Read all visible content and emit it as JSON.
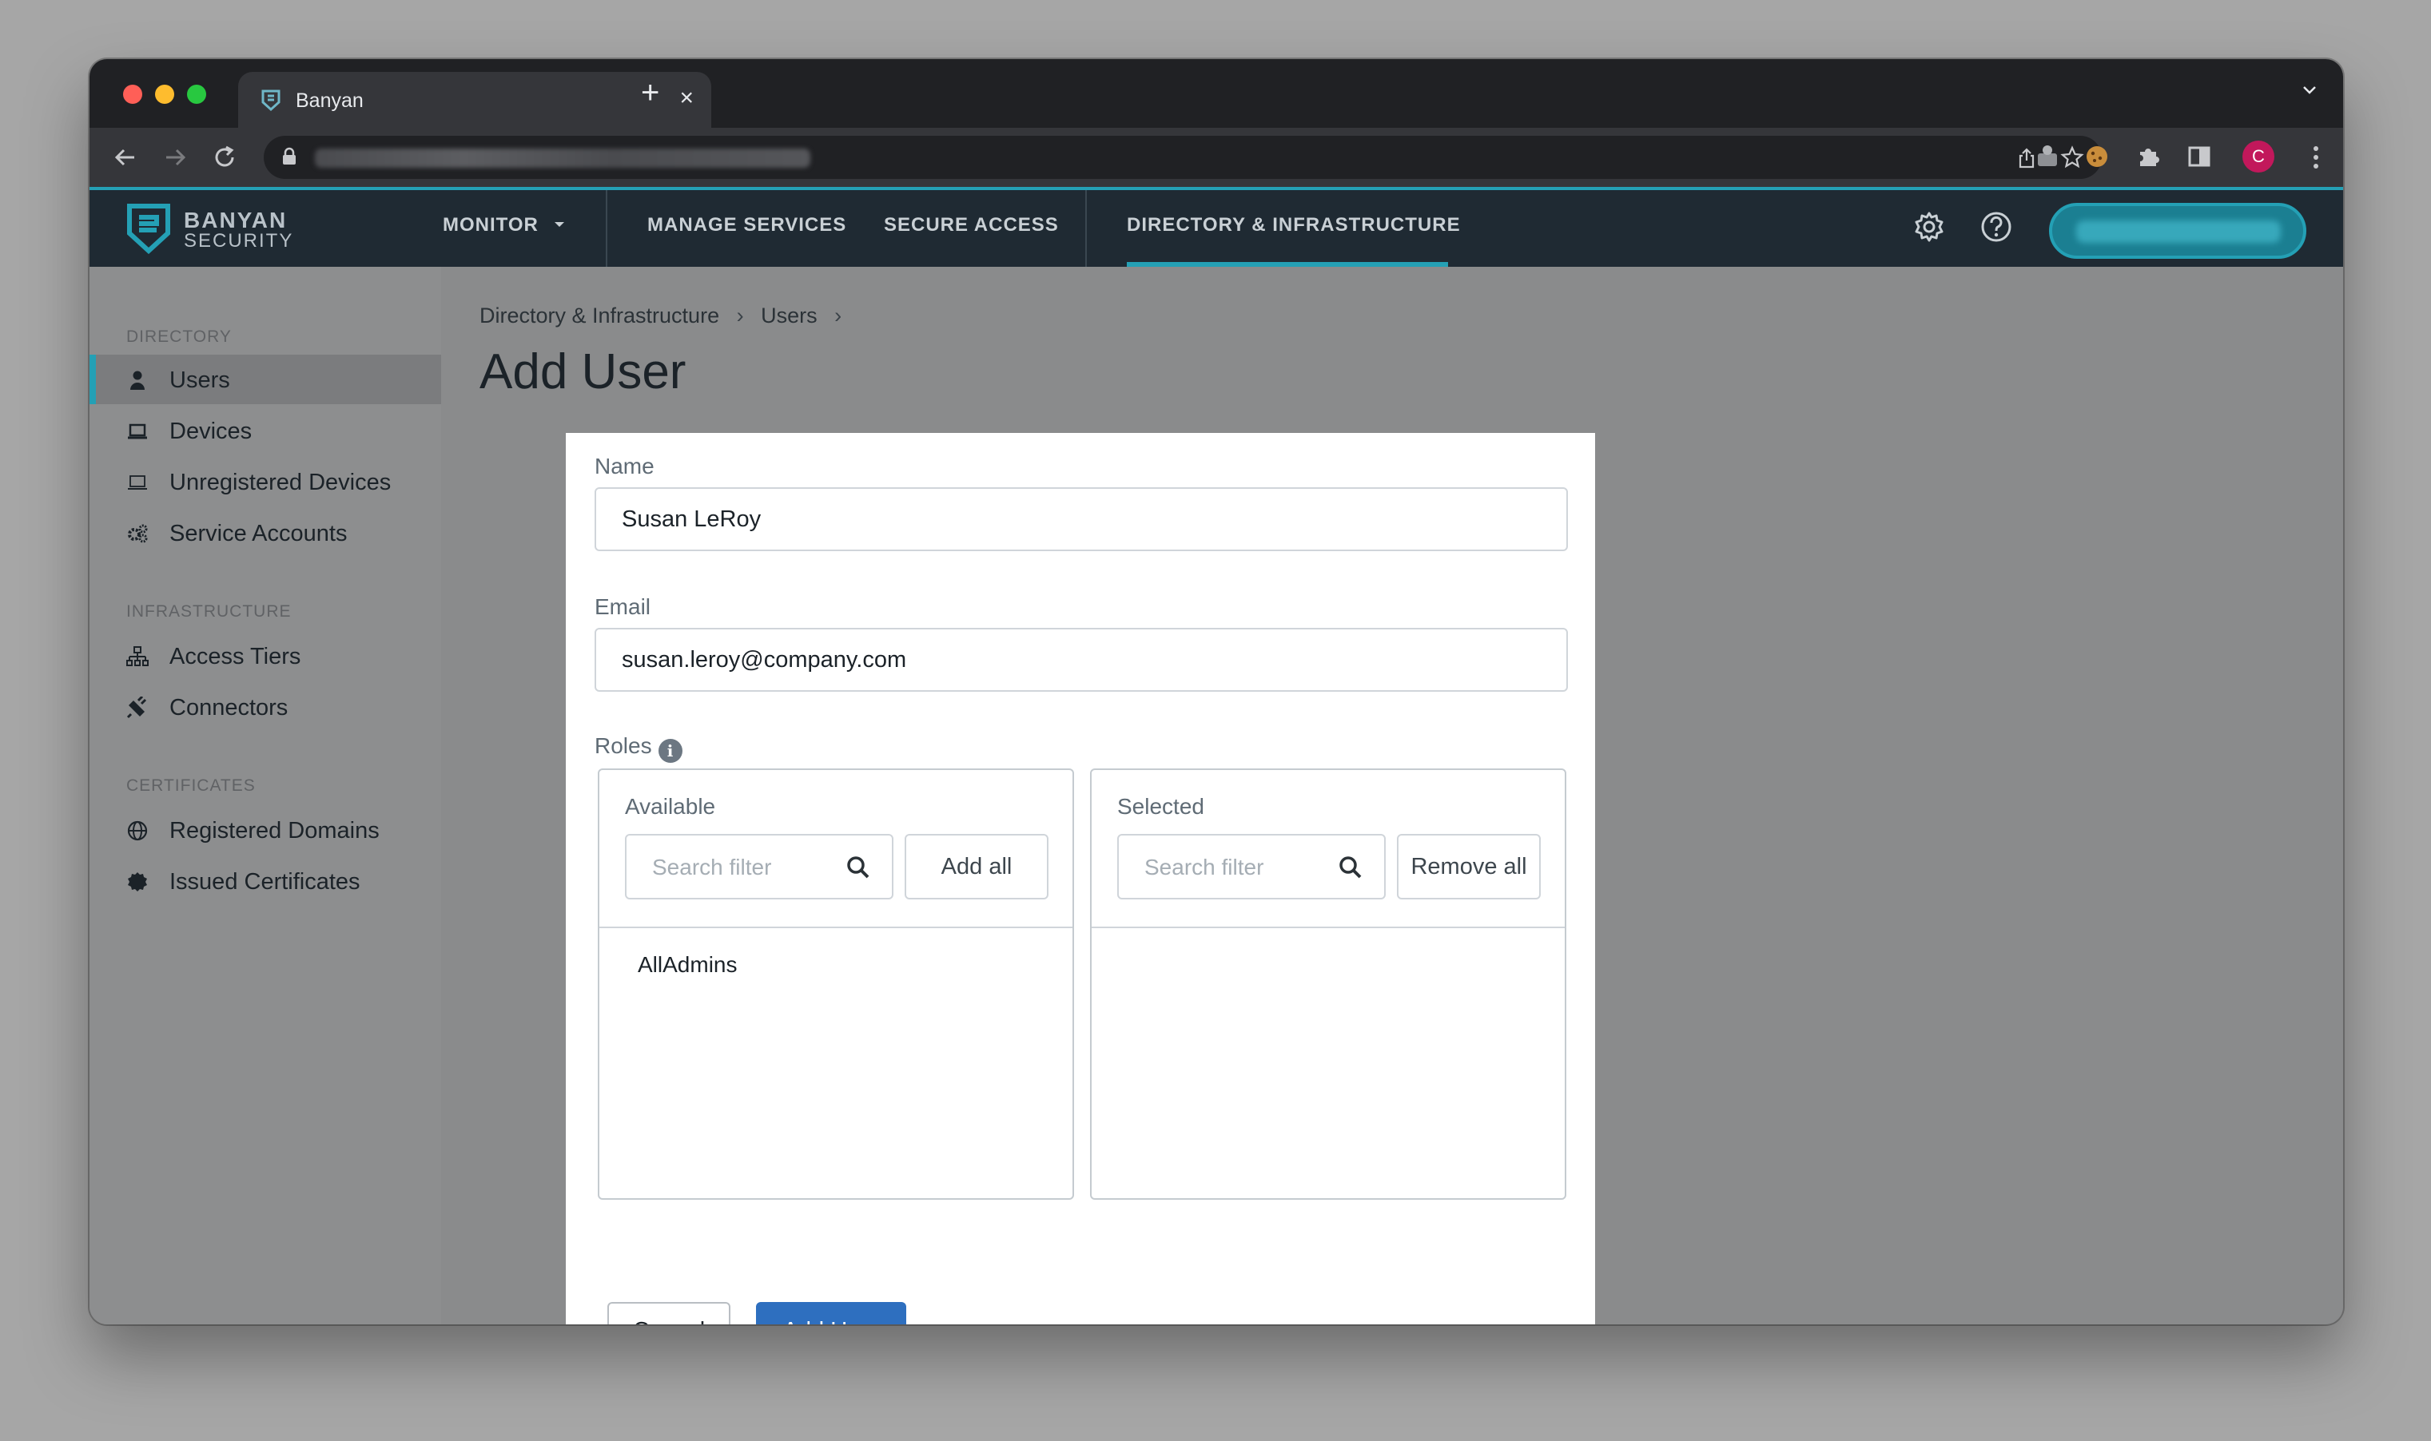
{
  "browser": {
    "tab_title": "Banyan",
    "tab_close": "×",
    "new_tab": "+"
  },
  "app": {
    "logo_line1": "BANYAN",
    "logo_line2": "SECURITY",
    "menu": {
      "monitor": "MONITOR",
      "manage_services": "MANAGE SERVICES",
      "secure_access": "SECURE ACCESS",
      "directory_infrastructure": "DIRECTORY & INFRASTRUCTURE"
    },
    "accent_color": "#24a0b5",
    "primary_button_color": "#2e6fbf"
  },
  "sidebar": {
    "sections": [
      {
        "title": "DIRECTORY",
        "items": [
          "Users",
          "Devices",
          "Unregistered Devices",
          "Service Accounts"
        ]
      },
      {
        "title": "INFRASTRUCTURE",
        "items": [
          "Access Tiers",
          "Connectors"
        ]
      },
      {
        "title": "CERTIFICATES",
        "items": [
          "Registered Domains",
          "Issued Certificates"
        ]
      }
    ],
    "active_item": "Users"
  },
  "breadcrumb": [
    "Directory & Infrastructure",
    "Users"
  ],
  "page_title": "Add User",
  "form": {
    "name_label": "Name",
    "name_value": "Susan LeRoy",
    "email_label": "Email",
    "email_value": "susan.leroy@company.com",
    "roles_label": "Roles",
    "available": {
      "title": "Available",
      "search_placeholder": "Search filter",
      "action": "Add all",
      "items": [
        "AllAdmins"
      ]
    },
    "selected": {
      "title": "Selected",
      "search_placeholder": "Search filter",
      "action": "Remove all",
      "items": []
    },
    "cancel_label": "Cancel",
    "submit_label": "Add User"
  }
}
